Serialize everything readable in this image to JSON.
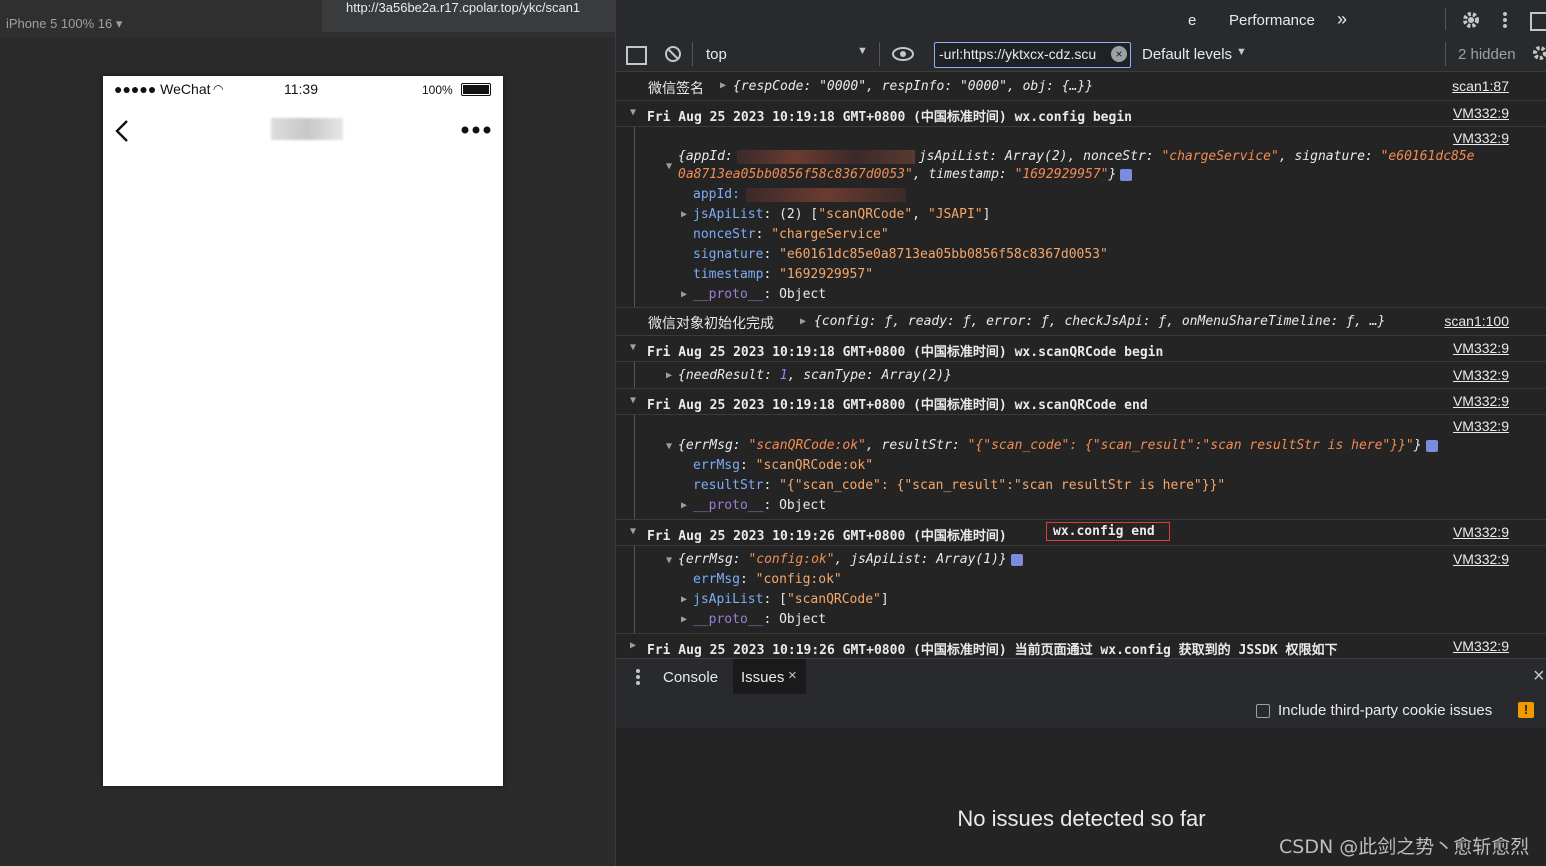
{
  "device_toolbar": {
    "label": "iPhone 5  100%  16 ▾",
    "url": "http://3a56be2a.r17.cpolar.top/ykc/scan1"
  },
  "phone": {
    "carrier": "●●●●● WeChat",
    "time": "11:39",
    "battery": "100%",
    "back_icon": "chevron-left-icon",
    "more_icon": "more-dots-icon"
  },
  "devtools": {
    "tabs": {
      "partial": "e",
      "performance": "Performance",
      "more": "»"
    },
    "toolbar": {
      "context": "top",
      "filter_value": "-url:https://yktxcx-cdz.scu",
      "levels": "Default levels",
      "hidden": "2 hidden"
    },
    "console": {
      "r1": {
        "msg": "微信签名",
        "obj": "{respCode: \"0000\", respInfo: \"0000\", obj: {…}}",
        "src": "scan1:87"
      },
      "r2": {
        "msg": "Fri Aug 25 2023 10:19:18 GMT+0800 (中国标准时间) wx.config begin",
        "src": "VM332:9"
      },
      "r3": {
        "src": "VM332:9",
        "line1a": "{appId:",
        "line1b": "jsApiList: Array(2), nonceStr: ",
        "line1c": "\"chargeService\"",
        "line1d": ", signature: ",
        "line1e": "\"e60161dc85e",
        "line2a": "0a8713ea05bb0856f58c8367d0053\"",
        "line2b": ", timestamp: ",
        "line2c": "\"1692929957\"",
        "line2d": "}",
        "appId": "appId:",
        "jsApiList_key": "jsApiList",
        "jsApiList_val": ": (2) [",
        "jsApiList_s1": "\"scanQRCode\"",
        "jsApiList_s2": "\"JSAPI\"",
        "nonceStr_key": "nonceStr",
        "nonceStr_val": "\"chargeService\"",
        "signature_key": "signature",
        "signature_val": "\"e60161dc85e0a8713ea05bb0856f58c8367d0053\"",
        "timestamp_key": "timestamp",
        "timestamp_val": "\"1692929957\"",
        "proto_key": "__proto__",
        "proto_val": "Object"
      },
      "r4": {
        "msg": "微信对象初始化完成",
        "obj": "{config: ƒ, ready: ƒ, error: ƒ, checkJsApi: ƒ, onMenuShareTimeline: ƒ, …}",
        "src": "scan1:100"
      },
      "r5": {
        "msg": "Fri Aug 25 2023 10:19:18 GMT+0800 (中国标准时间) wx.scanQRCode begin",
        "src": "VM332:9"
      },
      "r6": {
        "a": "{needResult: ",
        "b": "1",
        "c": ", scanType: Array(2)}",
        "src": "VM332:9"
      },
      "r7": {
        "msg": "Fri Aug 25 2023 10:19:18 GMT+0800 (中国标准时间) wx.scanQRCode end",
        "src": "VM332:9"
      },
      "r8": {
        "src": "VM332:9",
        "a": "{errMsg: ",
        "b": "\"scanQRCode:ok\"",
        "c": ", resultStr: ",
        "d": "\"{\"scan_code\": {\"scan_result\":\"scan resultStr is here\"}}\"",
        "e": "}",
        "errMsg_key": "errMsg",
        "errMsg_val": "\"scanQRCode:ok\"",
        "resultStr_key": "resultStr",
        "resultStr_val": "\"{\"scan_code\": {\"scan_result\":\"scan resultStr is here\"}}\"",
        "proto_key": "__proto__",
        "proto_val": "Object"
      },
      "r9": {
        "msg_a": "Fri Aug 25 2023 10:19:26 GMT+0800 (中国标准时间)",
        "msg_b": "wx.config end",
        "src": "VM332:9"
      },
      "r10": {
        "src": "VM332:9",
        "a": "{errMsg: ",
        "b": "\"config:ok\"",
        "c": ", jsApiList: Array(1)}",
        "errMsg_key": "errMsg",
        "errMsg_val": "\"config:ok\"",
        "jsApiList_key": "jsApiList",
        "jsApiList_a": ": [",
        "jsApiList_s": "\"scanQRCode\"",
        "jsApiList_b": "]",
        "proto_key": "__proto__",
        "proto_val": "Object"
      },
      "r11": {
        "msg": "Fri Aug 25 2023 10:19:26 GMT+0800 (中国标准时间) 当前页面通过 wx.config 获取到的 JSSDK 权限如下",
        "src": "VM332:9"
      }
    },
    "drawer": {
      "console_tab": "Console",
      "issues_tab": "Issues",
      "close": "×",
      "third_party": "Include third-party cookie issues",
      "empty": "No issues detected so far"
    }
  },
  "watermark": "CSDN @此剑之势丶愈斩愈烈"
}
